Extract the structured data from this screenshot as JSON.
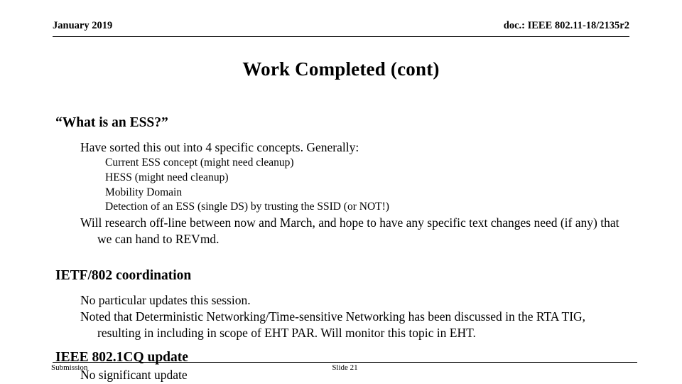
{
  "header": {
    "left": "January 2019",
    "right": "doc.: IEEE 802.11-18/2135r2"
  },
  "title": "Work Completed (cont)",
  "body": {
    "sections": [
      {
        "heading": "“What is an ESS?”",
        "lines": [
          "Have sorted this out into 4 specific concepts.  Generally:",
          "Current ESS concept (might need cleanup)",
          "HESS (might need cleanup)",
          "Mobility Domain",
          "Detection of an ESS (single DS) by trusting the SSID (or NOT!)",
          "Will research off-line between now and March, and hope to have any specific text changes need (if any) that we can hand to REVmd."
        ]
      },
      {
        "heading": "IETF/802 coordination",
        "lines": [
          "No particular updates this session.",
          "Noted that Deterministic Networking/Time-sensitive Networking has been discussed in the RTA TIG, resulting in including in scope of EHT PAR.  Will monitor this topic in EHT."
        ]
      },
      {
        "heading": "IEEE 802.1CQ update",
        "lines": [
          "No significant update"
        ]
      }
    ]
  },
  "footer": {
    "left": "Submission",
    "center": "Slide 21"
  }
}
